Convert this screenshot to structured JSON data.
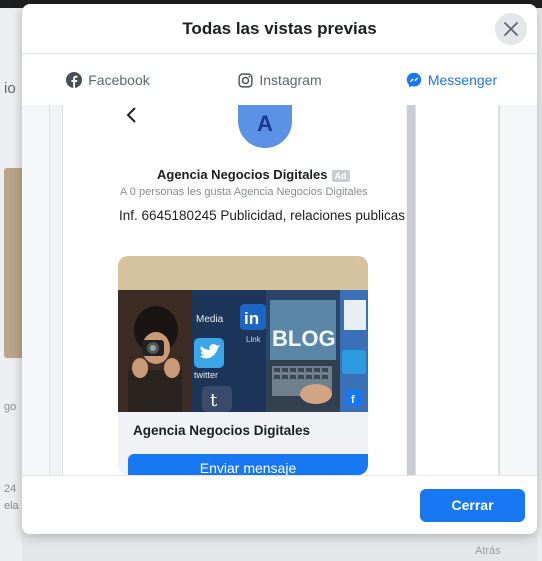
{
  "background": {
    "left_fragments": [
      "io",
      "go",
      "24",
      "ela"
    ],
    "bottom_text": "Atrás"
  },
  "modal": {
    "title": "Todas las vistas previas",
    "close_icon": "close-icon"
  },
  "tabs": [
    {
      "label": "Facebook",
      "icon": "facebook-icon",
      "active": false
    },
    {
      "label": "Instagram",
      "icon": "instagram-icon",
      "active": false
    },
    {
      "label": "Messenger",
      "icon": "messenger-icon",
      "active": true
    }
  ],
  "preview": {
    "avatar_letter": "A",
    "page_name": "Agencia Negocios Digitales",
    "ad_badge": "Ad",
    "likes": "A 0 personas les gusta Agencia Negocios Digitales",
    "description": "Inf. 6645180245 Publicidad, relaciones publicas",
    "card_title": "Agencia Negocios Digitales",
    "cta": "Enviar mensaje",
    "image_labels": {
      "media": "Media",
      "in": "in",
      "link": "Link",
      "twitter": "twitter",
      "blog": "BLOG"
    }
  },
  "footer": {
    "close_label": "Cerrar"
  },
  "colors": {
    "accent": "#1877f2",
    "avatar": "#5b92e5"
  }
}
